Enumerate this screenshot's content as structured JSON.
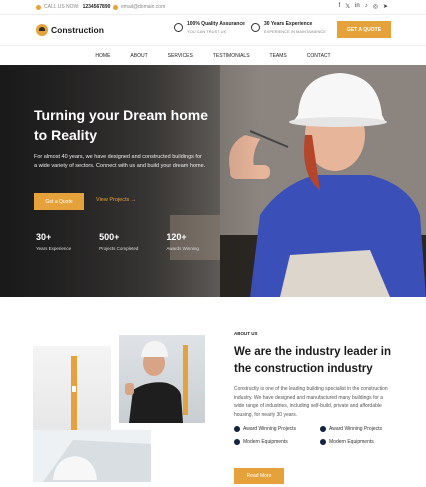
{
  "topbar": {
    "call_label": "CALL US NOW:",
    "phone": "1234567890",
    "email": "email@domain.com",
    "social_icons": [
      "facebook-icon",
      "twitter-icon",
      "linkedin-icon",
      "tiktok-icon",
      "instagram-icon",
      "telegram-icon"
    ]
  },
  "header": {
    "logo_text": "Construction",
    "feature1_title": "100% Quality Assurance",
    "feature1_sub": "YOU CAN TRUST US",
    "feature2_title": "30 Years Experience",
    "feature2_sub": "EXPERIENCE IN MAINTAINENCE",
    "cta": "GET A QUOTE"
  },
  "nav": {
    "items": [
      "HOME",
      "ABOUT",
      "SERVICES",
      "TESTIMONIALS",
      "TEAMS",
      "CONTACT"
    ]
  },
  "hero": {
    "title": "Turning your Dream home to Reality",
    "text": "For almost 40 years, we have designed and constructed buildings for a wide variety of sectors. Connect with us and build your dream home.",
    "btn_quote": "Get a Quote",
    "btn_projects": "View Projects →",
    "stats": [
      {
        "value": "30+",
        "label": "Years Experience"
      },
      {
        "value": "500+",
        "label": "Projects Completed"
      },
      {
        "value": "120+",
        "label": "Awards Winning"
      }
    ]
  },
  "about": {
    "kicker": "ABOUT US",
    "title": "We are the industry leader in the construction industry",
    "text": "Constructly is one of the leading building specialist in the construction industry. We have designed and manufactured many buildings for a wide range of industries, including self-build, private and affordable housing, for nearly 30 years.",
    "checks": [
      "Award Winning Projects",
      "Award Winning Projects",
      "Modern Equipments",
      "Modern Equipments"
    ],
    "btn": "Read More"
  },
  "colors": {
    "accent": "#e5a23a",
    "dark": "#12233d"
  }
}
